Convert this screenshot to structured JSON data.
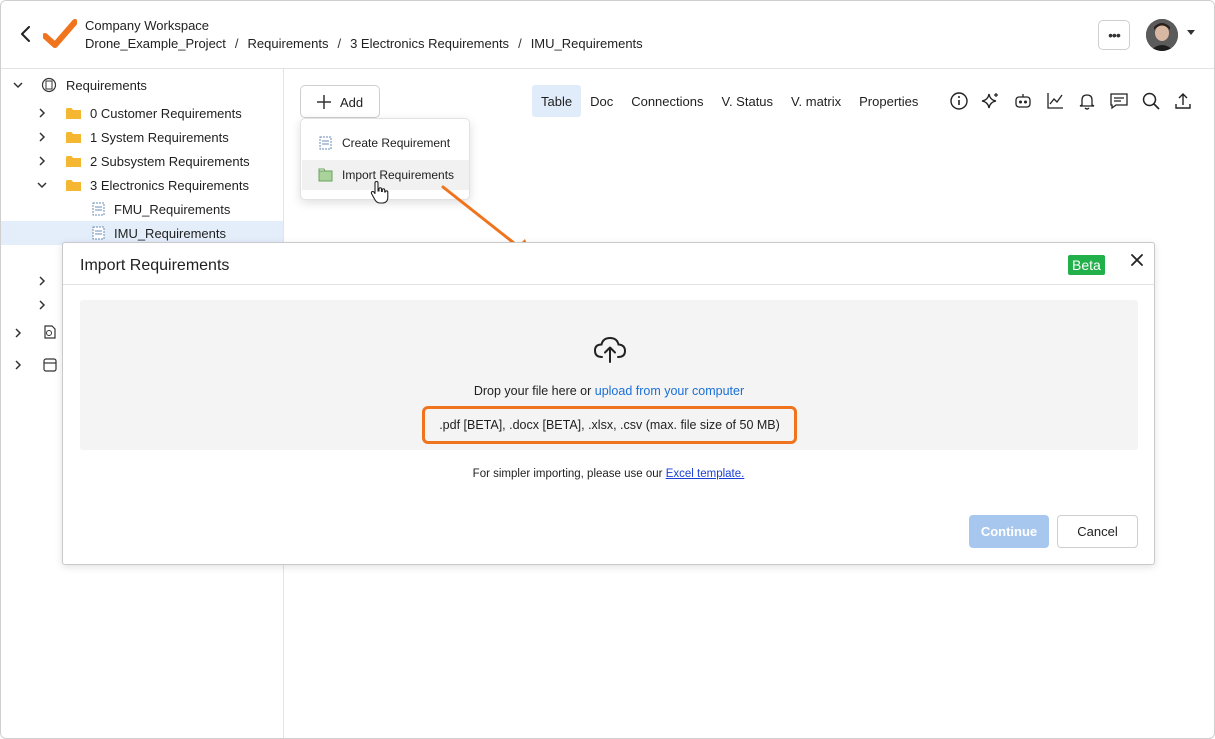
{
  "header": {
    "workspace": "Company Workspace",
    "breadcrumbs": [
      "Drone_Example_Project",
      "Requirements",
      "3 Electronics Requirements",
      "IMU_Requirements"
    ],
    "breadcrumb_separator": "/",
    "more_label": "•••"
  },
  "sidebar": {
    "root_label": "Requirements",
    "folders": [
      "0 Customer Requirements",
      "1 System Requirements",
      "2 Subsystem Requirements",
      "3 Electronics Requirements"
    ],
    "children": [
      "FMU_Requirements",
      "IMU_Requirements"
    ],
    "selected": "IMU_Requirements"
  },
  "toolbar": {
    "add_label": "Add",
    "tabs": [
      "Table",
      "Doc",
      "Connections",
      "V. Status",
      "V. matrix",
      "Properties"
    ],
    "active_tab": "Table",
    "icons": [
      "info-icon",
      "sparkle-icon",
      "robot-icon",
      "chart-icon",
      "bell-icon",
      "comment-icon",
      "search-icon",
      "upload-icon"
    ]
  },
  "add_menu": {
    "items": [
      "Create Requirement",
      "Import Requirements"
    ],
    "hovered": "Import Requirements"
  },
  "modal": {
    "title": "Import Requirements",
    "badge": "Beta",
    "drop_text": "Drop your file here or ",
    "drop_link": "upload from your computer",
    "formats": ".pdf [BETA], .docx [BETA], .xlsx, .csv (max. file size of 50 MB)",
    "hint_text": "For simpler importing, please use our ",
    "hint_link": "Excel template.",
    "continue_label": "Continue",
    "cancel_label": "Cancel"
  },
  "colors": {
    "accent_orange": "#f0731d",
    "link_blue": "#1a6fd6",
    "beta_green": "#22b04b",
    "continue_disabled": "#a7c7ee",
    "selected_row": "#e4eefb",
    "active_tab": "#e1ecfa"
  }
}
